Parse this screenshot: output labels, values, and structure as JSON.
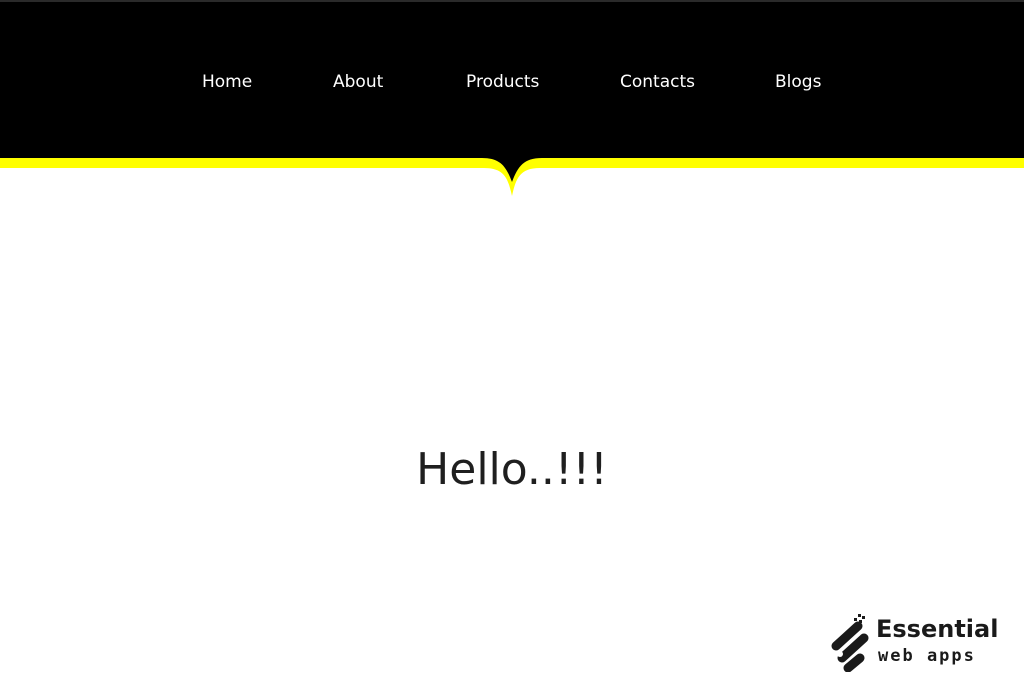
{
  "nav": {
    "items": [
      {
        "label": "Home"
      },
      {
        "label": "About"
      },
      {
        "label": "Products"
      },
      {
        "label": "Contacts"
      },
      {
        "label": "Blogs"
      }
    ]
  },
  "hero": {
    "text": "Hello..!!!"
  },
  "logo": {
    "line1": "Essential",
    "line2": "web apps",
    "icon": "essential-web-apps-logo-icon"
  },
  "colors": {
    "header_background": "#000000",
    "accent_border": "#ffff00",
    "page_background": "#ffffff",
    "nav_text": "#ffffff",
    "hero_text": "#1f1f1f"
  }
}
